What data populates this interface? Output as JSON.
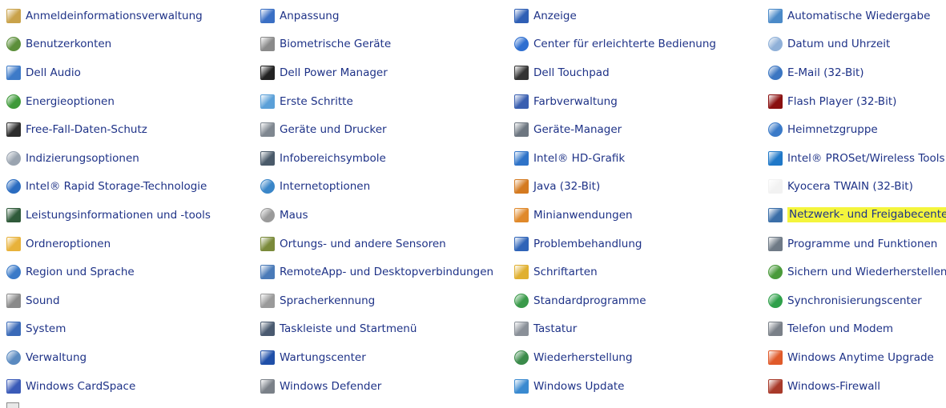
{
  "highlight_color": "#f4f53c",
  "link_color": "#1e3287",
  "items": [
    {
      "label": "Anmeldeinformationsverwaltung",
      "icon": "credential-manager-icon",
      "color": "#c9a24a",
      "round": false
    },
    {
      "label": "Anpassung",
      "icon": "personalization-icon",
      "color": "#3a6fc4",
      "round": false
    },
    {
      "label": "Anzeige",
      "icon": "display-icon",
      "color": "#2f5fb5",
      "round": false
    },
    {
      "label": "Automatische Wiedergabe",
      "icon": "autoplay-icon",
      "color": "#4b8ac8",
      "round": false
    },
    {
      "label": "Benutzerkonten",
      "icon": "user-accounts-icon",
      "color": "#5c8f3a",
      "round": true
    },
    {
      "label": "Biometrische Geräte",
      "icon": "biometric-devices-icon",
      "color": "#8a8a8a",
      "round": false
    },
    {
      "label": "Center für erleichterte Bedienung",
      "icon": "ease-of-access-icon",
      "color": "#2f6fd0",
      "round": true
    },
    {
      "label": "Datum und Uhrzeit",
      "icon": "date-time-icon",
      "color": "#8fb0d8",
      "round": true
    },
    {
      "label": "Dell Audio",
      "icon": "dell-audio-icon",
      "color": "#3d7ac8",
      "round": false
    },
    {
      "label": "Dell Power Manager",
      "icon": "dell-power-manager-icon",
      "color": "#222222",
      "round": false
    },
    {
      "label": "Dell Touchpad",
      "icon": "dell-touchpad-icon",
      "color": "#333333",
      "round": false
    },
    {
      "label": "E-Mail (32-Bit)",
      "icon": "email-icon",
      "color": "#3b76c2",
      "round": true
    },
    {
      "label": "Energieoptionen",
      "icon": "power-options-icon",
      "color": "#3f9a3a",
      "round": true
    },
    {
      "label": "Erste Schritte",
      "icon": "getting-started-icon",
      "color": "#5ba0d8",
      "round": false
    },
    {
      "label": "Farbverwaltung",
      "icon": "color-management-icon",
      "color": "#3a5fb0",
      "round": false
    },
    {
      "label": "Flash Player (32-Bit)",
      "icon": "flash-player-icon",
      "color": "#8a1010",
      "round": false
    },
    {
      "label": "Free-Fall-Daten-Schutz",
      "icon": "free-fall-icon",
      "color": "#2c2c2c",
      "round": false
    },
    {
      "label": "Geräte und Drucker",
      "icon": "devices-printers-icon",
      "color": "#7f8790",
      "round": false
    },
    {
      "label": "Geräte-Manager",
      "icon": "device-manager-icon",
      "color": "#6d7680",
      "round": false
    },
    {
      "label": "Heimnetzgruppe",
      "icon": "homegroup-icon",
      "color": "#3a7ac8",
      "round": true
    },
    {
      "label": "Indizierungsoptionen",
      "icon": "indexing-options-icon",
      "color": "#9aa4b0",
      "round": true
    },
    {
      "label": "Infobereichsymbole",
      "icon": "notification-icons-icon",
      "color": "#4a5a6a",
      "round": false
    },
    {
      "label": "Intel® HD-Grafik",
      "icon": "intel-graphics-icon",
      "color": "#2f73c8",
      "round": false
    },
    {
      "label": "Intel® PROSet/Wireless Tools",
      "icon": "intel-wireless-icon",
      "color": "#1f78c8",
      "round": false
    },
    {
      "label": "Intel® Rapid Storage-Technologie",
      "icon": "intel-rapid-storage-icon",
      "color": "#2b6cc0",
      "round": true
    },
    {
      "label": "Internetoptionen",
      "icon": "internet-options-icon",
      "color": "#3a86c8",
      "round": true
    },
    {
      "label": "Java (32-Bit)",
      "icon": "java-icon",
      "color": "#d47a20",
      "round": false
    },
    {
      "label": "Kyocera TWAIN (32-Bit)",
      "icon": "kyocera-twain-icon",
      "color": "#f2f2f2",
      "round": false
    },
    {
      "label": "Leistungsinformationen und -tools",
      "icon": "performance-icon",
      "color": "#2f5a3a",
      "round": false
    },
    {
      "label": "Maus",
      "icon": "mouse-icon",
      "color": "#9a9a9a",
      "round": true
    },
    {
      "label": "Minianwendungen",
      "icon": "gadgets-icon",
      "color": "#e0892a",
      "round": false
    },
    {
      "label": "Netzwerk- und Freigabecenter",
      "icon": "network-sharing-icon",
      "color": "#3a6ea8",
      "round": false,
      "highlight": true
    },
    {
      "label": "Ordneroptionen",
      "icon": "folder-options-icon",
      "color": "#e8b23a",
      "round": false
    },
    {
      "label": "Ortungs- und andere Sensoren",
      "icon": "location-sensors-icon",
      "color": "#7a8a3a",
      "round": false
    },
    {
      "label": "Problembehandlung",
      "icon": "troubleshooting-icon",
      "color": "#2f64b8",
      "round": false
    },
    {
      "label": "Programme und Funktionen",
      "icon": "programs-features-icon",
      "color": "#6f7a86",
      "round": false
    },
    {
      "label": "Region und Sprache",
      "icon": "region-language-icon",
      "color": "#3a7ac8",
      "round": true
    },
    {
      "label": "RemoteApp- und Desktopverbindungen",
      "icon": "remoteapp-icon",
      "color": "#4a7ab8",
      "round": false
    },
    {
      "label": "Schriftarten",
      "icon": "fonts-icon",
      "color": "#e0b030",
      "round": false
    },
    {
      "label": "Sichern und Wiederherstellen",
      "icon": "backup-restore-icon",
      "color": "#4a9a3a",
      "round": true
    },
    {
      "label": "Sound",
      "icon": "sound-icon",
      "color": "#8a8a8a",
      "round": false
    },
    {
      "label": "Spracherkennung",
      "icon": "speech-recognition-icon",
      "color": "#9a9a9a",
      "round": false
    },
    {
      "label": "Standardprogramme",
      "icon": "default-programs-icon",
      "color": "#3a9a4a",
      "round": true
    },
    {
      "label": "Synchronisierungscenter",
      "icon": "sync-center-icon",
      "color": "#2fa04a",
      "round": true
    },
    {
      "label": "System",
      "icon": "system-icon",
      "color": "#3a6ab8",
      "round": false
    },
    {
      "label": "Taskleiste und Startmenü",
      "icon": "taskbar-icon",
      "color": "#4a5a70",
      "round": false
    },
    {
      "label": "Tastatur",
      "icon": "keyboard-icon",
      "color": "#8a9098",
      "round": false
    },
    {
      "label": "Telefon und Modem",
      "icon": "phone-modem-icon",
      "color": "#7a8088",
      "round": false
    },
    {
      "label": "Verwaltung",
      "icon": "administrative-tools-icon",
      "color": "#5a8ac0",
      "round": true
    },
    {
      "label": "Wartungscenter",
      "icon": "action-center-icon",
      "color": "#1f4fa8",
      "round": false
    },
    {
      "label": "Wiederherstellung",
      "icon": "recovery-icon",
      "color": "#3a8a4a",
      "round": true
    },
    {
      "label": "Windows Anytime Upgrade",
      "icon": "anytime-upgrade-icon",
      "color": "#e05a2a",
      "round": false
    },
    {
      "label": "Windows CardSpace",
      "icon": "cardspace-icon",
      "color": "#3a5ab8",
      "round": false
    },
    {
      "label": "Windows Defender",
      "icon": "windows-defender-icon",
      "color": "#7a8088",
      "round": false
    },
    {
      "label": "Windows Update",
      "icon": "windows-update-icon",
      "color": "#3a8ad0",
      "round": false
    },
    {
      "label": "Windows-Firewall",
      "icon": "windows-firewall-icon",
      "color": "#a83a2a",
      "round": false
    }
  ]
}
